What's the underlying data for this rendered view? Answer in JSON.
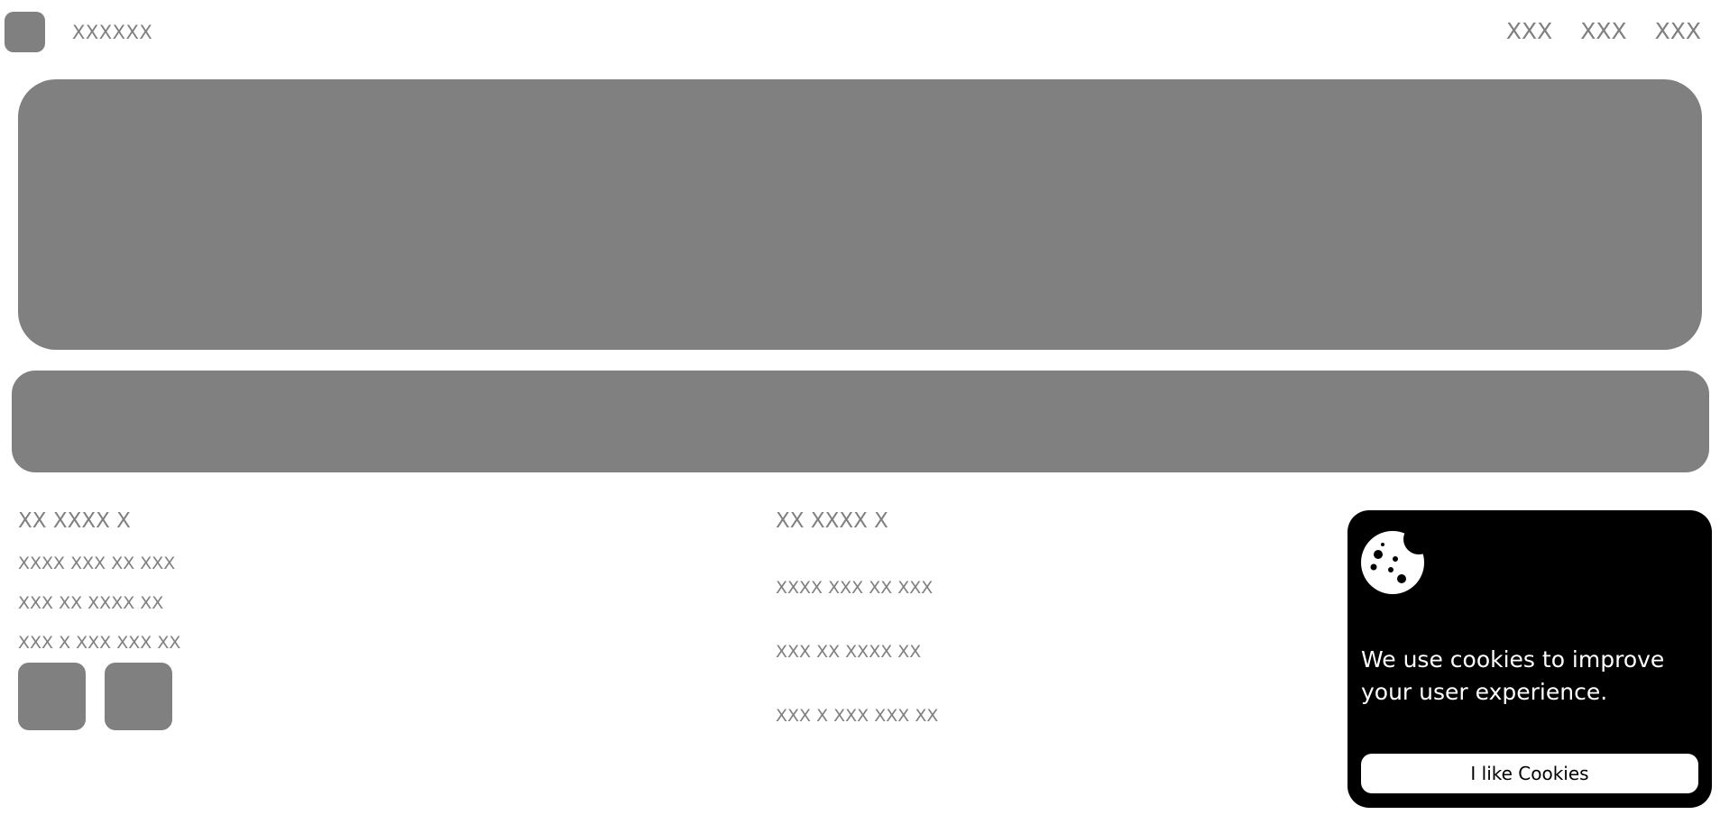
{
  "header": {
    "brand": "XXXXXX",
    "nav": [
      "XXX",
      "XXX",
      "XXX"
    ]
  },
  "footer": {
    "col1": {
      "heading": "XX XXXX X",
      "links": [
        "XXXX XXX XX XXX",
        "XXX XX XXXX XX",
        "XXX X XXX XXX XX"
      ]
    },
    "col2": {
      "heading": "XX XXXX X",
      "links": [
        "XXXX XXX XX XXX",
        "XXX XX XXXX XX",
        "XXX X XXX XXX XX"
      ]
    }
  },
  "cookie": {
    "icon": "cookie-icon",
    "message": "We use cookies to improve your user experience.",
    "button_label": "I like Cookies"
  },
  "colors": {
    "placeholder_gray": "#808080",
    "cookie_bg": "#000000",
    "cookie_text": "#ffffff"
  }
}
